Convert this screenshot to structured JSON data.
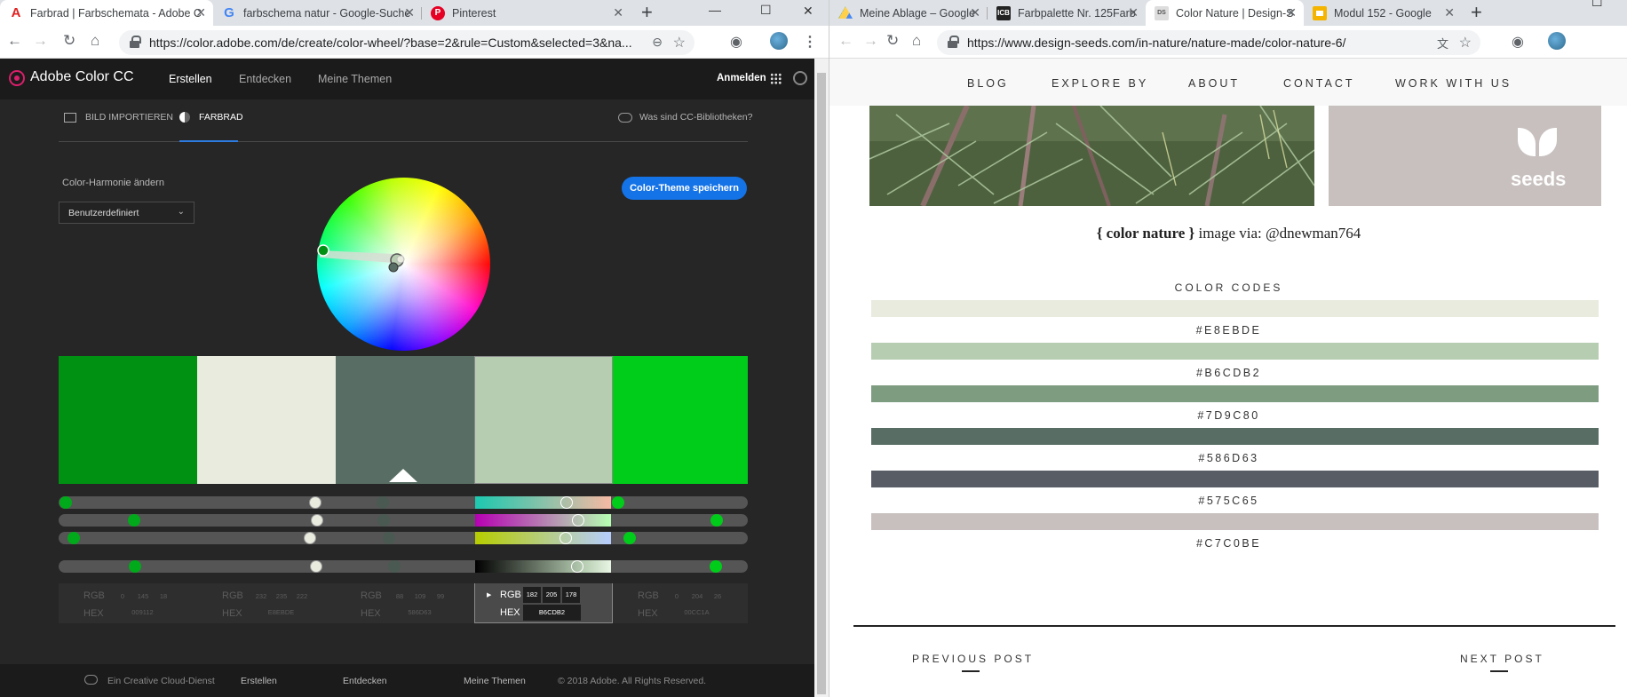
{
  "left_window": {
    "tabs": [
      {
        "title": "Farbrad | Farbschemata - Adobe C",
        "icon": "adobe-icon",
        "color": "#e01f1f"
      },
      {
        "title": "farbschema natur - Google-Suche",
        "icon": "google-icon",
        "color": "#4285f4"
      },
      {
        "title": "Pinterest",
        "icon": "pinterest-icon",
        "color": "#e60023"
      }
    ],
    "url": "https://color.adobe.com/de/create/color-wheel/?base=2&rule=Custom&selected=3&na...",
    "app": {
      "brand": "Adobe Color CC",
      "nav": [
        "Erstellen",
        "Entdecken",
        "Meine Themen"
      ],
      "login": "Anmelden",
      "subtabs": [
        "BILD IMPORTIEREN",
        "FARBRAD"
      ],
      "cc_link": "Was sind CC-Bibliotheken?",
      "harmony_label": "Color-Harmonie ändern",
      "harmony_value": "Benutzerdefiniert",
      "save_button": "Color-Theme speichern",
      "swatches": [
        {
          "hex": "#009112",
          "rgb": [
            "0",
            "145",
            "18"
          ],
          "hex_label": "009112",
          "selected": false
        },
        {
          "hex": "#E8EBDE",
          "rgb": [
            "232",
            "235",
            "222"
          ],
          "hex_label": "E8EBDE",
          "selected": false
        },
        {
          "hex": "#586D63",
          "rgb": [
            "88",
            "109",
            "99"
          ],
          "hex_label": "586D63",
          "selected": false
        },
        {
          "hex": "#B6CDB2",
          "rgb": [
            "182",
            "205",
            "178"
          ],
          "hex_label": "B6CDB2",
          "selected": true
        },
        {
          "hex": "#00CC1A",
          "rgb": [
            "0",
            "204",
            "26"
          ],
          "hex_label": "00CC1A",
          "selected": false
        }
      ],
      "rgb_label": "RGB",
      "hex_label": "HEX",
      "footer": [
        "Ein Creative Cloud-Dienst",
        "Erstellen",
        "Entdecken",
        "Meine Themen",
        "© 2018 Adobe. All Rights Reserved."
      ]
    }
  },
  "right_window": {
    "tabs": [
      {
        "title": "Meine Ablage – Google",
        "icon": "drive-icon",
        "color": "#1fa463"
      },
      {
        "title": "Farbpalette Nr. 125Farb",
        "icon": "icb-icon",
        "color": "#222222"
      },
      {
        "title": "Color Nature | Design-S",
        "icon": "design-seeds-icon",
        "color": "#777777"
      },
      {
        "title": "Modul 152 - Google",
        "icon": "slides-icon",
        "color": "#f4b400"
      }
    ],
    "url": "https://www.design-seeds.com/in-nature/nature-made/color-nature-6/",
    "site": {
      "nav": [
        "BLOG",
        "EXPLORE BY",
        "ABOUT",
        "CONTACT",
        "WORK WITH US"
      ],
      "logo_text": "seeds",
      "caption_bold": "{ color nature }",
      "caption_rest": " image via: @dnewman764",
      "codes_title": "COLOR CODES",
      "colors": [
        {
          "code": "#E8EBDE",
          "hex": "#E8EBDE"
        },
        {
          "code": "#B6CDB2",
          "hex": "#B6CDB2"
        },
        {
          "code": "#7D9C80",
          "hex": "#7D9C80"
        },
        {
          "code": "#586D63",
          "hex": "#586D63"
        },
        {
          "code": "#575C65",
          "hex": "#575C65"
        },
        {
          "code": "#C7C0BE",
          "hex": "#C7C0BE"
        }
      ],
      "prev_post": "PREVIOUS POST",
      "next_post": "NEXT POST"
    }
  }
}
